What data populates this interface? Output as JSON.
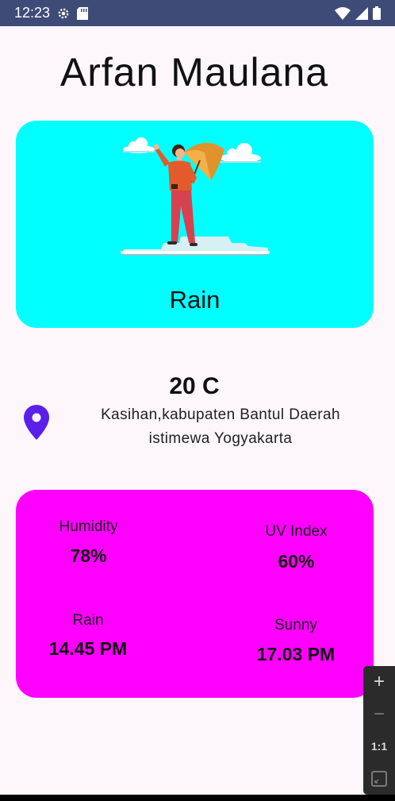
{
  "status_bar": {
    "time": "12:23",
    "icons": [
      "settings-icon",
      "sd-card-icon",
      "wifi-icon",
      "signal-icon",
      "battery-icon"
    ]
  },
  "app": {
    "title": "Arfan Maulana"
  },
  "weather": {
    "condition": "Rain",
    "temperature": "20 C",
    "location": "Kasihan,kabupaten Bantul Daerah istimewa Yogyakarta",
    "card_color": "#00ffff",
    "illustration": "person-with-umbrella-illustration"
  },
  "stats": {
    "card_color": "#ff00ff",
    "humidity_label": "Humidity",
    "humidity_value": "78%",
    "uv_label": "UV Index",
    "uv_value": "60%",
    "rain_label": "Rain",
    "rain_value": "14.45 PM",
    "sunny_label": "Sunny",
    "sunny_value": "17.03 PM"
  },
  "zoom_controls": {
    "zoom_in": "+",
    "zoom_out": "−",
    "actual_size": "1:1",
    "fit_icon": "fit-screen-icon"
  },
  "colors": {
    "status_bar": "#3f4b77",
    "location_pin": "#5a1fe8"
  }
}
